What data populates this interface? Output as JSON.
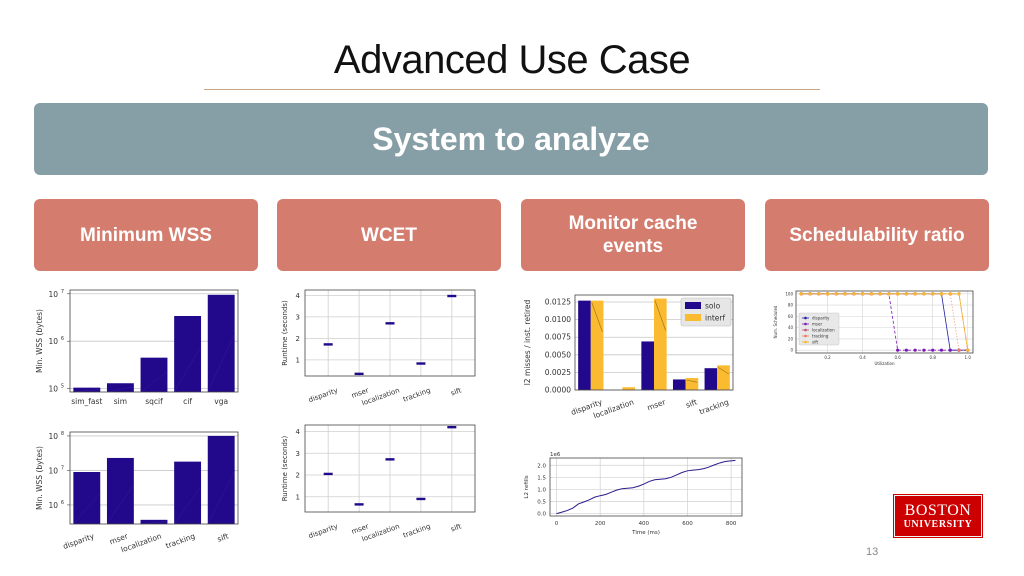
{
  "slide": {
    "title": "Advanced Use Case",
    "banner": "System to analyze",
    "cards": [
      "Minimum WSS",
      "WCET",
      "Monitor cache events",
      "Schedulability ratio"
    ],
    "logo": {
      "line1": "BOSTON",
      "line2": "UNIVERSITY"
    },
    "page_number": "13"
  },
  "colors": {
    "banner": "#869ea6",
    "card": "#d47d6f",
    "bar_solo": "#22088a",
    "bar_interf": "#fbbb30",
    "logo": "#cc0000",
    "rule": "#c8a882"
  },
  "chart_data": [
    {
      "id": "wss-resolutions",
      "type": "bar",
      "ylabel": "Min. WSS (bytes)",
      "yscale": "log",
      "ylim": [
        85000,
        12000000
      ],
      "yticks": [
        {
          "v": 100000,
          "base": "10",
          "exp": "5"
        },
        {
          "v": 1000000,
          "base": "10",
          "exp": "6"
        },
        {
          "v": 10000000,
          "base": "10",
          "exp": "7"
        }
      ],
      "categories": [
        "sim_fast",
        "sim",
        "sqcif",
        "cif",
        "vga"
      ],
      "values": [
        105000,
        130000,
        450000,
        3400000,
        9500000
      ],
      "grid": "horizontal"
    },
    {
      "id": "wss-benchmarks",
      "type": "bar",
      "ylabel": "Min. WSS (bytes)",
      "yscale": "log",
      "ylim": [
        280000,
        130000000
      ],
      "yticks": [
        {
          "v": 1000000,
          "base": "10",
          "exp": "6"
        },
        {
          "v": 10000000,
          "base": "10",
          "exp": "7"
        },
        {
          "v": 100000000,
          "base": "10",
          "exp": "8"
        }
      ],
      "categories": [
        "disparity",
        "mser",
        "localization",
        "tracking",
        "sift"
      ],
      "values": [
        9000000,
        23000000,
        370000,
        18000000,
        100000000
      ],
      "grid": "horizontal"
    },
    {
      "id": "wcet-1",
      "type": "box",
      "ylabel": "Runtime (seconds)",
      "ylim": [
        0.25,
        4.25
      ],
      "yticks": [
        1,
        2,
        3,
        4
      ],
      "categories": [
        "disparity",
        "mser",
        "localization",
        "tracking",
        "sift"
      ],
      "values": [
        1.72,
        0.35,
        2.7,
        0.83,
        3.97
      ],
      "grid": "both"
    },
    {
      "id": "wcet-2",
      "type": "box",
      "ylabel": "Runtime (seconds)",
      "ylim": [
        0.3,
        4.3
      ],
      "yticks": [
        1,
        2,
        3,
        4
      ],
      "categories": [
        "disparity",
        "mser",
        "localization",
        "tracking",
        "sift"
      ],
      "values": [
        2.05,
        0.65,
        2.72,
        0.9,
        4.2
      ],
      "grid": "both"
    },
    {
      "id": "cache-misses",
      "type": "bar",
      "ylabel": "l2 misses / inst. retired",
      "ylim": [
        0,
        0.0135
      ],
      "yticks": [
        "0.0000",
        "0.0025",
        "0.0050",
        "0.0075",
        "0.0100",
        "0.0125"
      ],
      "categories": [
        "disparity",
        "localization",
        "mser",
        "sift",
        "tracking"
      ],
      "series": [
        {
          "name": "solo",
          "values": [
            0.0127,
            0.0,
            0.0069,
            0.0015,
            0.0031
          ]
        },
        {
          "name": "interf",
          "values": [
            0.0127,
            0.0004,
            0.013,
            0.0017,
            0.0035
          ]
        }
      ],
      "legend": "top-right",
      "grid": "horizontal"
    },
    {
      "id": "l2-refills",
      "type": "line",
      "ylabel": "L2 refills",
      "xlabel": "Time (ms)",
      "offset_label": "1e6",
      "xlim": [
        -30,
        850
      ],
      "ylim": [
        -0.1,
        2.3
      ],
      "xticks": [
        0,
        200,
        400,
        600,
        800
      ],
      "yticks": [
        "0.0",
        "0.5",
        "1.0",
        "1.5",
        "2.0"
      ],
      "x": [
        0,
        25,
        50,
        75,
        100,
        125,
        150,
        175,
        200,
        225,
        250,
        275,
        300,
        325,
        350,
        375,
        400,
        425,
        450,
        475,
        500,
        525,
        550,
        575,
        600,
        625,
        650,
        675,
        700,
        725,
        750,
        775,
        800,
        820
      ],
      "values": [
        0.0,
        0.06,
        0.13,
        0.23,
        0.4,
        0.48,
        0.57,
        0.68,
        0.74,
        0.79,
        0.88,
        0.97,
        1.03,
        1.05,
        1.07,
        1.13,
        1.22,
        1.33,
        1.4,
        1.42,
        1.44,
        1.5,
        1.6,
        1.7,
        1.77,
        1.8,
        1.82,
        1.86,
        1.93,
        2.02,
        2.1,
        2.16,
        2.18,
        2.2
      ],
      "grid": "both"
    },
    {
      "id": "schedulability",
      "type": "line",
      "ylabel": "Num. Scheduled",
      "xlabel": "Utilization",
      "xlim": [
        0.02,
        1.03
      ],
      "ylim": [
        -5,
        105
      ],
      "xticks": [
        "0.2",
        "0.4",
        "0.6",
        "0.8",
        "1.0"
      ],
      "yticks": [
        0,
        20,
        40,
        60,
        80,
        100
      ],
      "x": [
        0.05,
        0.1,
        0.15,
        0.2,
        0.25,
        0.3,
        0.35,
        0.4,
        0.45,
        0.5,
        0.55,
        0.6,
        0.65,
        0.7,
        0.75,
        0.8,
        0.85,
        0.9,
        0.95,
        1.0
      ],
      "series": [
        {
          "name": "disparity",
          "color": "#1f1fa0",
          "marker": "v",
          "dash": "",
          "values": [
            100,
            100,
            100,
            100,
            100,
            100,
            100,
            100,
            100,
            100,
            100,
            100,
            100,
            100,
            100,
            100,
            100,
            0,
            0,
            0
          ]
        },
        {
          "name": "mser",
          "color": "#7b18b8",
          "marker": "o",
          "dash": "3,2",
          "values": [
            100,
            100,
            100,
            100,
            100,
            100,
            100,
            100,
            100,
            100,
            100,
            0,
            0,
            0,
            0,
            0,
            0,
            0,
            0,
            0
          ]
        },
        {
          "name": "localization",
          "color": "#c0507a",
          "marker": "^",
          "dash": "5,2,1,2",
          "values": [
            100,
            100,
            100,
            100,
            100,
            100,
            100,
            100,
            100,
            100,
            100,
            100,
            100,
            100,
            100,
            100,
            100,
            100,
            100,
            0
          ]
        },
        {
          "name": "tracking",
          "color": "#ee7a60",
          "marker": "<",
          "dash": "1,2",
          "values": [
            100,
            100,
            100,
            100,
            100,
            100,
            100,
            100,
            100,
            100,
            100,
            100,
            100,
            100,
            100,
            100,
            100,
            100,
            0,
            0
          ]
        },
        {
          "name": "sift",
          "color": "#f5b830",
          "marker": "o",
          "dash": "",
          "values": [
            100,
            100,
            100,
            100,
            100,
            100,
            100,
            100,
            100,
            100,
            100,
            100,
            100,
            100,
            100,
            100,
            100,
            100,
            100,
            0
          ]
        }
      ],
      "legend": "center-left",
      "grid": "both"
    }
  ]
}
